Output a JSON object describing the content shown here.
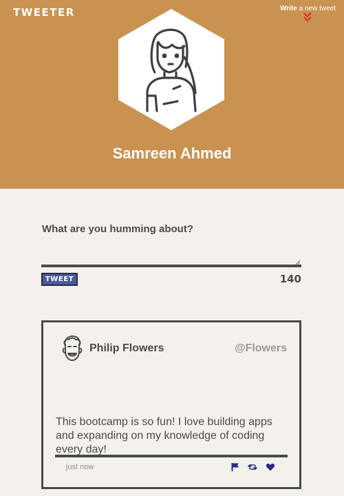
{
  "header": {
    "brand": "TWEETER",
    "write_link_bold": "Write",
    "write_link_rest": " a new tweet",
    "profile_name": "Samreen Ahmed",
    "background_color": "#c99250"
  },
  "composer": {
    "label": "What are you humming about?",
    "value": "",
    "tweet_button_label": "TWEET",
    "char_count": "140",
    "button_color": "#4a5b9e"
  },
  "tweet": {
    "user_name": "Philip Flowers",
    "handle": "@Flowers",
    "body": "This bootcamp is so fun! I love building apps and expanding on my knowledge of coding every day!",
    "timestamp": "just now",
    "actions": [
      "flag-icon",
      "retweet-icon",
      "heart-icon"
    ],
    "action_color": "#2c2a8c"
  }
}
